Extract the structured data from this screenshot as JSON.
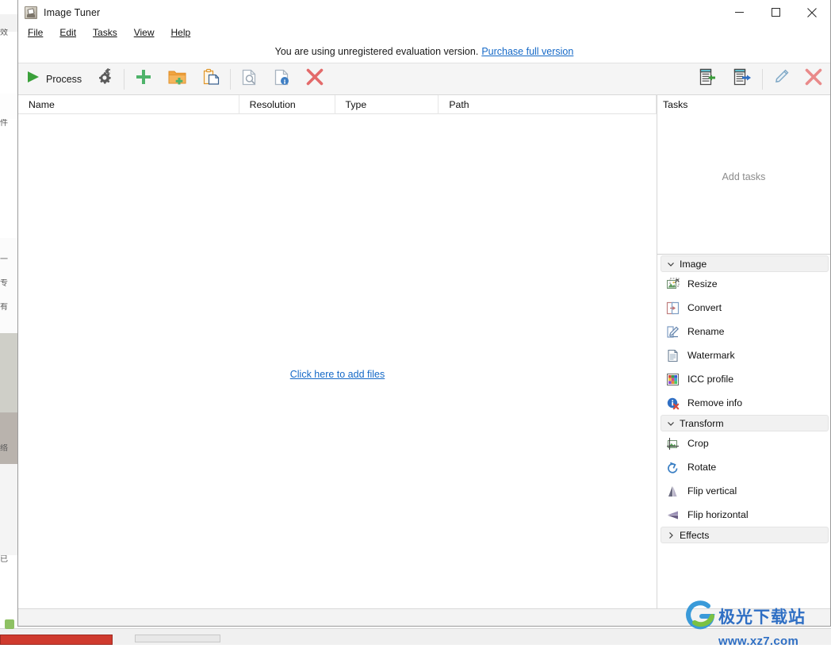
{
  "window": {
    "title": "Image Tuner",
    "app_icon": "camera-icon",
    "controls": {
      "minimize": "minimize-icon",
      "maximize": "maximize-icon",
      "close": "close-icon"
    }
  },
  "menubar": {
    "items": [
      {
        "label": "File",
        "accel": "F"
      },
      {
        "label": "Edit",
        "accel": "E"
      },
      {
        "label": "Tasks",
        "accel": "T"
      },
      {
        "label": "View",
        "accel": "V"
      },
      {
        "label": "Help",
        "accel": "H"
      }
    ]
  },
  "nag": {
    "message": "You are using unregistered evaluation version.",
    "link_label": "Purchase full version",
    "link_color": "#1569c7"
  },
  "toolbar": {
    "process_label": "Process",
    "process_icon": "play-icon",
    "settings_icon": "gear-icon",
    "add_files_icon": "plus-icon",
    "add_folder_icon": "folder-add-icon",
    "paste_icon": "paste-icon",
    "preview_icon": "preview-magnifier-icon",
    "info_icon": "file-info-icon",
    "remove_icon": "remove-red-x-icon",
    "import_list_icon": "import-list-icon",
    "export_list_icon": "export-list-icon",
    "edit_task_icon": "pencil-edit-icon",
    "delete_task_icon": "delete-red-x-icon"
  },
  "file_list": {
    "columns": [
      "Name",
      "Resolution",
      "Type",
      "Path"
    ],
    "rows": [],
    "empty_link": "Click here to add files"
  },
  "tasks_panel": {
    "header": "Tasks",
    "placeholder": "Add tasks",
    "groups": [
      {
        "name": "Image",
        "expanded": true,
        "chevron": "chevron-down-icon",
        "items": [
          {
            "label": "Resize",
            "icon": "resize-image-icon"
          },
          {
            "label": "Convert",
            "icon": "convert-format-icon"
          },
          {
            "label": "Rename",
            "icon": "rename-pencil-icon"
          },
          {
            "label": "Watermark",
            "icon": "watermark-document-icon"
          },
          {
            "label": "ICC profile",
            "icon": "icc-color-grid-icon"
          },
          {
            "label": "Remove info",
            "icon": "remove-info-icon"
          }
        ]
      },
      {
        "name": "Transform",
        "expanded": true,
        "chevron": "chevron-down-icon",
        "items": [
          {
            "label": "Crop",
            "icon": "crop-icon"
          },
          {
            "label": "Rotate",
            "icon": "rotate-icon"
          },
          {
            "label": "Flip vertical",
            "icon": "flip-vertical-icon"
          },
          {
            "label": "Flip horizontal",
            "icon": "flip-horizontal-icon"
          }
        ]
      },
      {
        "name": "Effects",
        "expanded": false,
        "chevron": "chevron-right-icon",
        "items": []
      }
    ]
  },
  "watermark": {
    "cjk_text": "极光下载站",
    "url_text": "www.xz7.com",
    "color": "#2f6fc4"
  },
  "background": {
    "cjk_fragments": [
      "效",
      "件",
      "一",
      "专",
      "有",
      "络",
      "已"
    ]
  }
}
